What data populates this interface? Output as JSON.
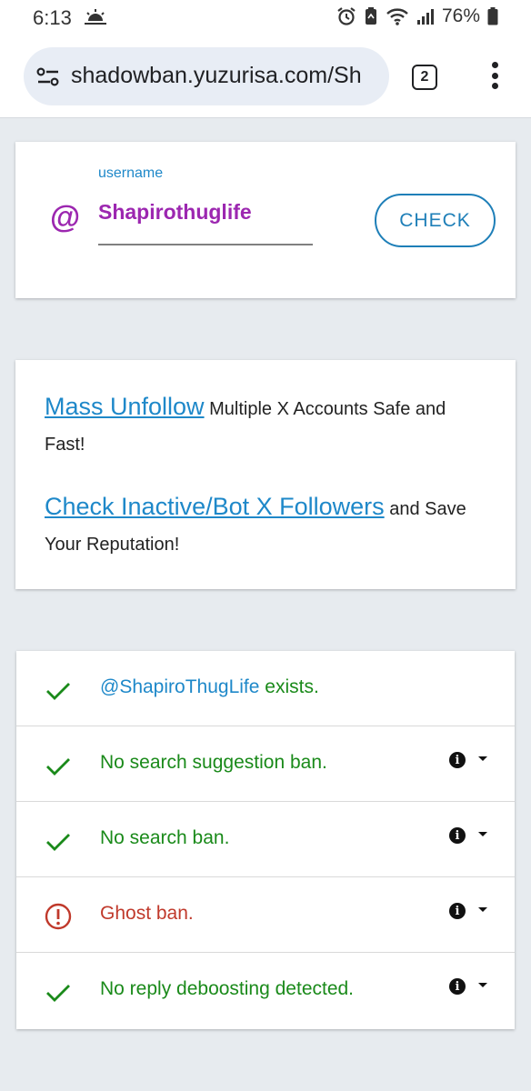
{
  "status_bar": {
    "time": "6:13",
    "battery": "76%",
    "icons": [
      "sunrise-icon",
      "alarm-icon",
      "recycle-icon",
      "wifi-icon",
      "signal-icon",
      "battery-icon"
    ]
  },
  "browser": {
    "url": "shadowban.yuzurisa.com/Sh",
    "tab_count": "2"
  },
  "form": {
    "label": "username",
    "at_symbol": "@",
    "value": "Shapirothuglife",
    "check_label": "CHECK"
  },
  "ads": [
    {
      "link": "Mass Unfollow",
      "text": " Multiple X Accounts Safe and Fast!"
    },
    {
      "link": "Check Inactive/Bot X Followers",
      "text": " and Save Your Reputation!"
    }
  ],
  "results": {
    "exists_handle": "@ShapiroThugLife",
    "exists_text": " exists.",
    "items": [
      {
        "status": "ok",
        "text": "No search suggestion ban."
      },
      {
        "status": "ok",
        "text": "No search ban."
      },
      {
        "status": "bad",
        "text": "Ghost ban."
      },
      {
        "status": "ok",
        "text": "No reply deboosting detected."
      }
    ]
  },
  "colors": {
    "ok": "#1a8a1a",
    "bad": "#c0392b",
    "accent": "#1e88c9",
    "purple": "#9c27b0"
  }
}
